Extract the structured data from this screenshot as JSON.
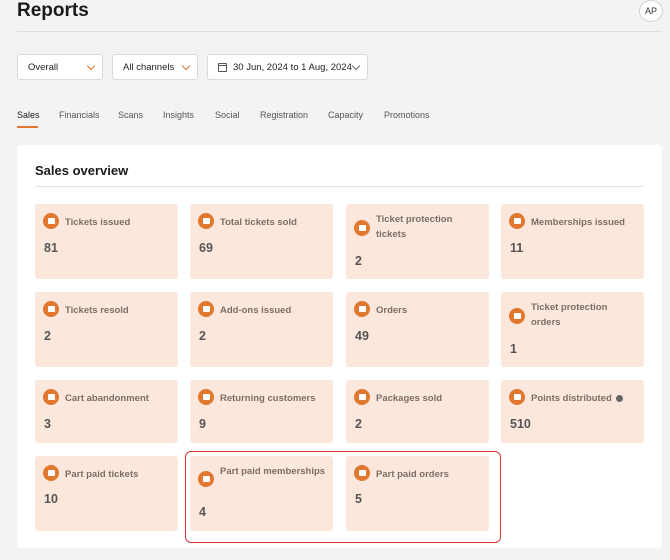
{
  "header": {
    "title": "Reports",
    "avatar_initials": "AP"
  },
  "filters": {
    "scope": "Overall",
    "channels": "All channels",
    "date_range": "30 Jun, 2024 to 1 Aug, 2024"
  },
  "tabs": [
    "Sales",
    "Financials",
    "Scans",
    "Insights",
    "Social",
    "Registration",
    "Capacity",
    "Promotions"
  ],
  "active_tab": "Sales",
  "overview": {
    "title": "Sales overview",
    "cards": [
      {
        "label": "Tickets issued",
        "value": "81",
        "icon": "ticket-icon"
      },
      {
        "label": "Total tickets sold",
        "value": "69",
        "icon": "ticket-icon"
      },
      {
        "label": "Ticket protection tickets",
        "value": "2",
        "icon": "cart-icon"
      },
      {
        "label": "Memberships issued",
        "value": "11",
        "icon": "membership-card-icon"
      },
      {
        "label": "Tickets resold",
        "value": "2",
        "icon": "resale-icon"
      },
      {
        "label": "Add-ons issued",
        "value": "2",
        "icon": "cart-plus-icon"
      },
      {
        "label": "Orders",
        "value": "49",
        "icon": "order-icon"
      },
      {
        "label": "Ticket protection orders",
        "value": "1",
        "icon": "cart-icon"
      },
      {
        "label": "Cart abandonment",
        "value": "3",
        "icon": "cart-icon"
      },
      {
        "label": "Returning customers",
        "value": "9",
        "icon": "user-badge-icon"
      },
      {
        "label": "Packages sold",
        "value": "2",
        "icon": "package-icon"
      },
      {
        "label": "Points distributed",
        "value": "510",
        "icon": "points-icon"
      },
      {
        "label": "Part paid tickets",
        "value": "10",
        "icon": "ticket-icon"
      },
      {
        "label": "Part paid memberships",
        "value": "4",
        "icon": "ticket-icon"
      },
      {
        "label": "Part paid orders",
        "value": "5",
        "icon": "order-icon"
      }
    ]
  },
  "colors": {
    "accent": "#e0792f",
    "card_bg": "#fce7dc",
    "highlight": "#e03232"
  }
}
